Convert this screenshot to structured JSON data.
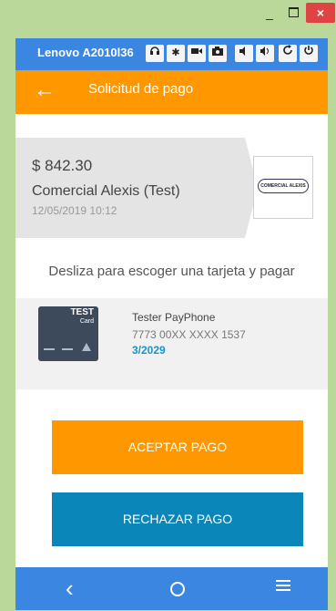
{
  "window": {
    "controls": {
      "minimize": "_",
      "close": "×"
    }
  },
  "device_toolbar": {
    "device_name": "Lenovo A2010l36",
    "buttons": [
      "headset-icon",
      "gear-icon",
      "video-icon",
      "camera-icon",
      "volume-down-icon",
      "volume-up-icon",
      "rotate-icon",
      "power-icon"
    ]
  },
  "appbar": {
    "back_icon": "←",
    "title": "Solicitud de pago"
  },
  "payment": {
    "amount": "$ 842.30",
    "merchant": "Comercial Alexis (Test)",
    "datetime": "12/05/2019 10:12",
    "logo_text": "COMERCIAL ALEXIS"
  },
  "swipe_hint": "Desliza para escoger una tarjeta y pagar",
  "card": {
    "brand_title": "TEST",
    "brand_sub": "Card",
    "holder": "Tester PayPhone",
    "number": "7773 00XX XXXX 1537",
    "expiry": "3/2029"
  },
  "actions": {
    "accept": "ACEPTAR PAGO",
    "reject": "RECHAZAR PAGO"
  },
  "bottom_nav": {
    "back": "‹"
  },
  "colors": {
    "accent": "#ff9800",
    "primary": "#3b86e0",
    "reject": "#0a86b8",
    "expiry": "#1c93c8"
  }
}
